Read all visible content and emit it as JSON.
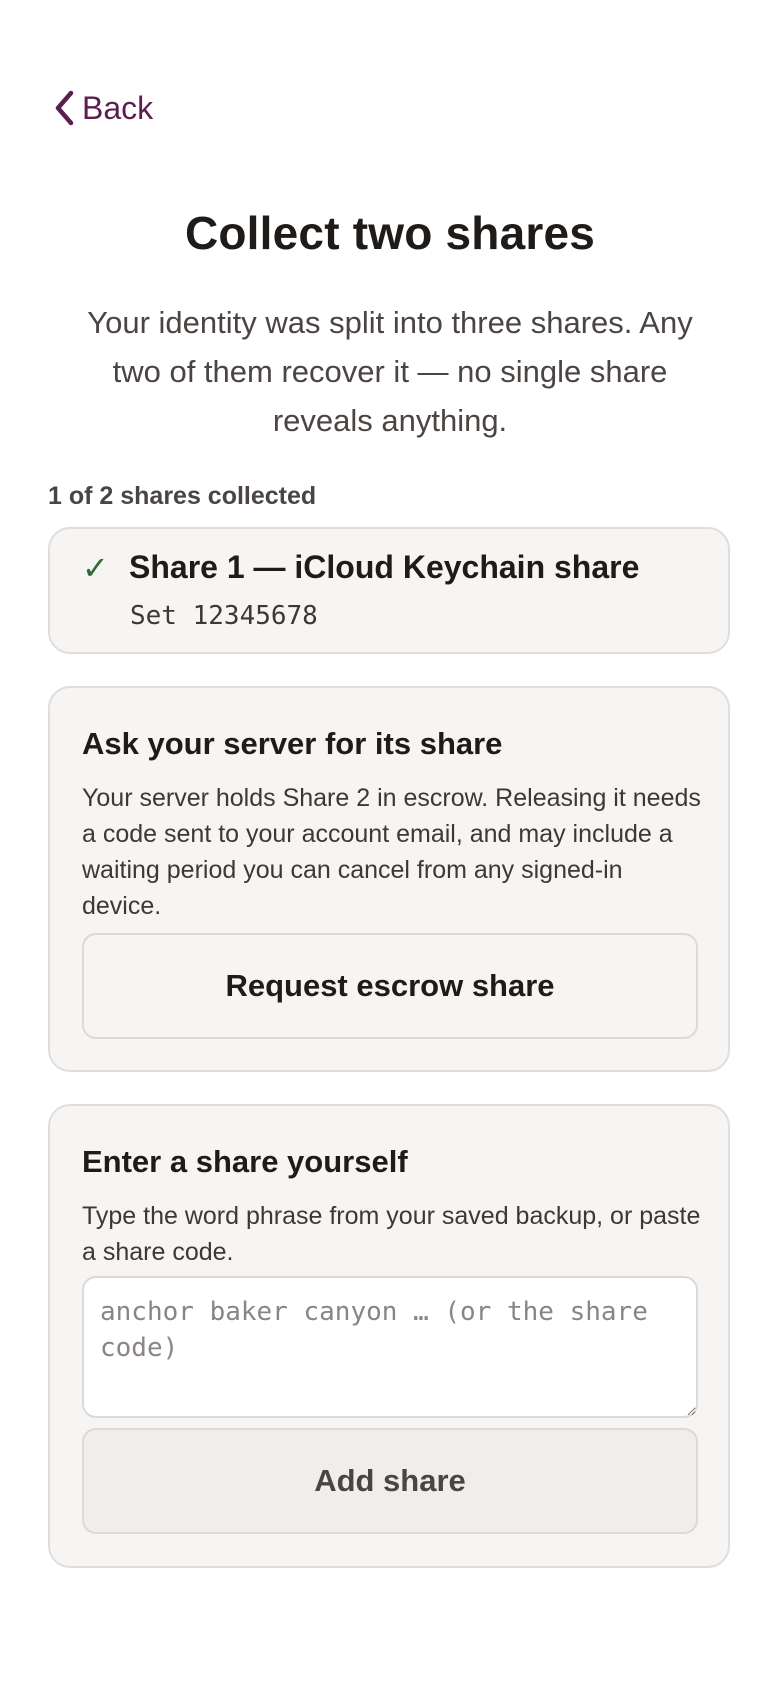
{
  "nav": {
    "back_label": "Back",
    "back_icon": "chevron-left-icon"
  },
  "header": {
    "title": "Collect two shares",
    "subtitle": "Your identity was split into three shares. Any two of them recover it — no single share reveals anything."
  },
  "progress": {
    "label": "1 of 2 shares collected",
    "collected": 1,
    "required": 2
  },
  "collected_shares": [
    {
      "check_icon": "✓",
      "title": "Share 1 — iCloud Keychain share",
      "set": "Set 12345678"
    }
  ],
  "escrow": {
    "heading": "Ask your server for its share",
    "description": "Your server holds Share 2 in escrow. Releasing it needs a code sent to your account email, and may include a waiting period you can cancel from any signed-in device.",
    "button_label": "Request escrow share"
  },
  "manual": {
    "heading": "Enter a share yourself",
    "description": "Type the word phrase from your saved backup, or paste a share code.",
    "input_value": "",
    "input_placeholder": "anchor baker canyon … (or the share code)",
    "button_label": "Add share"
  },
  "colors": {
    "accent": "#5b1f4f",
    "success": "#2f6b35",
    "card_bg": "#f6f5f3",
    "card_border": "#e0ddda"
  }
}
